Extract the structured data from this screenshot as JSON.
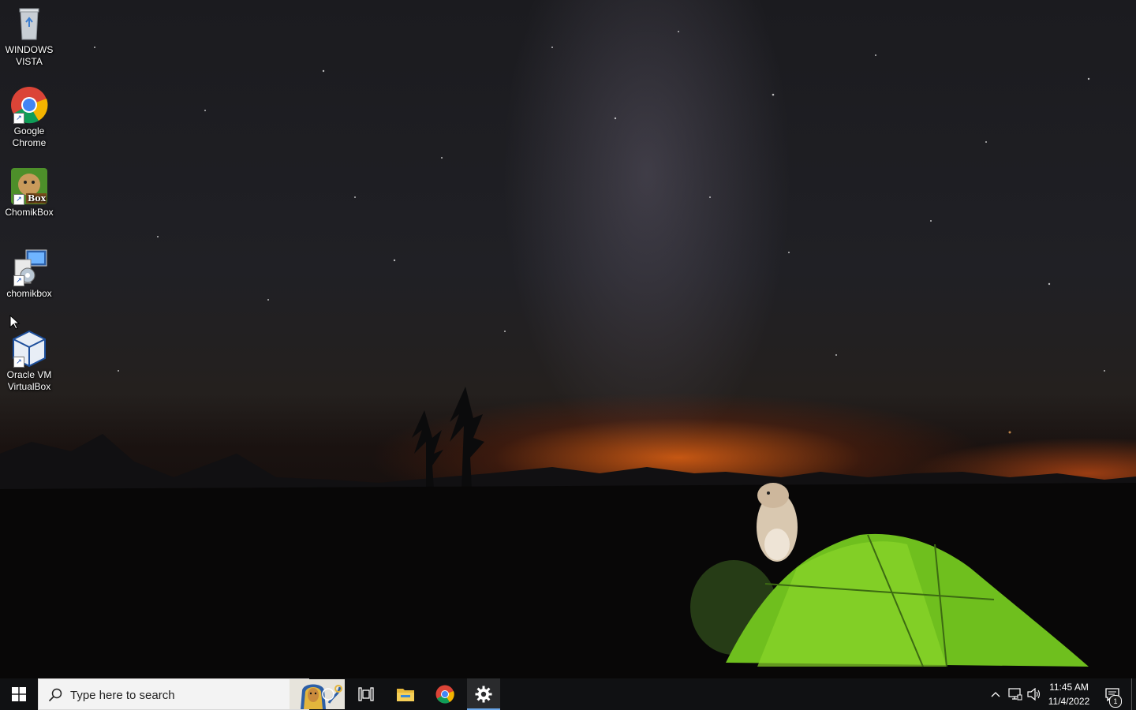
{
  "desktop": {
    "icons": [
      {
        "label": "WINDOWS VISTA",
        "icon": "recycle-bin-icon"
      },
      {
        "label": "Google Chrome",
        "icon": "chrome-icon"
      },
      {
        "label": "ChomikBox",
        "icon": "chomikbox-icon",
        "badge_text": "Box"
      },
      {
        "label": "chomikbox",
        "icon": "installer-icon"
      },
      {
        "label": "Oracle VM VirtualBox",
        "icon": "virtualbox-icon"
      }
    ]
  },
  "taskbar": {
    "search_placeholder": "Type here to search",
    "pinned": [
      "cortana-icon",
      "task-view-icon",
      "file-explorer-icon",
      "chrome-icon",
      "settings-icon"
    ],
    "active_app": "settings",
    "accent_color": "#6aa6e8"
  },
  "tray": {
    "icons": [
      "chevron-up-icon",
      "network-icon",
      "volume-icon"
    ],
    "time": "11:45 AM",
    "date": "11/4/2022",
    "notification_count": "1"
  }
}
